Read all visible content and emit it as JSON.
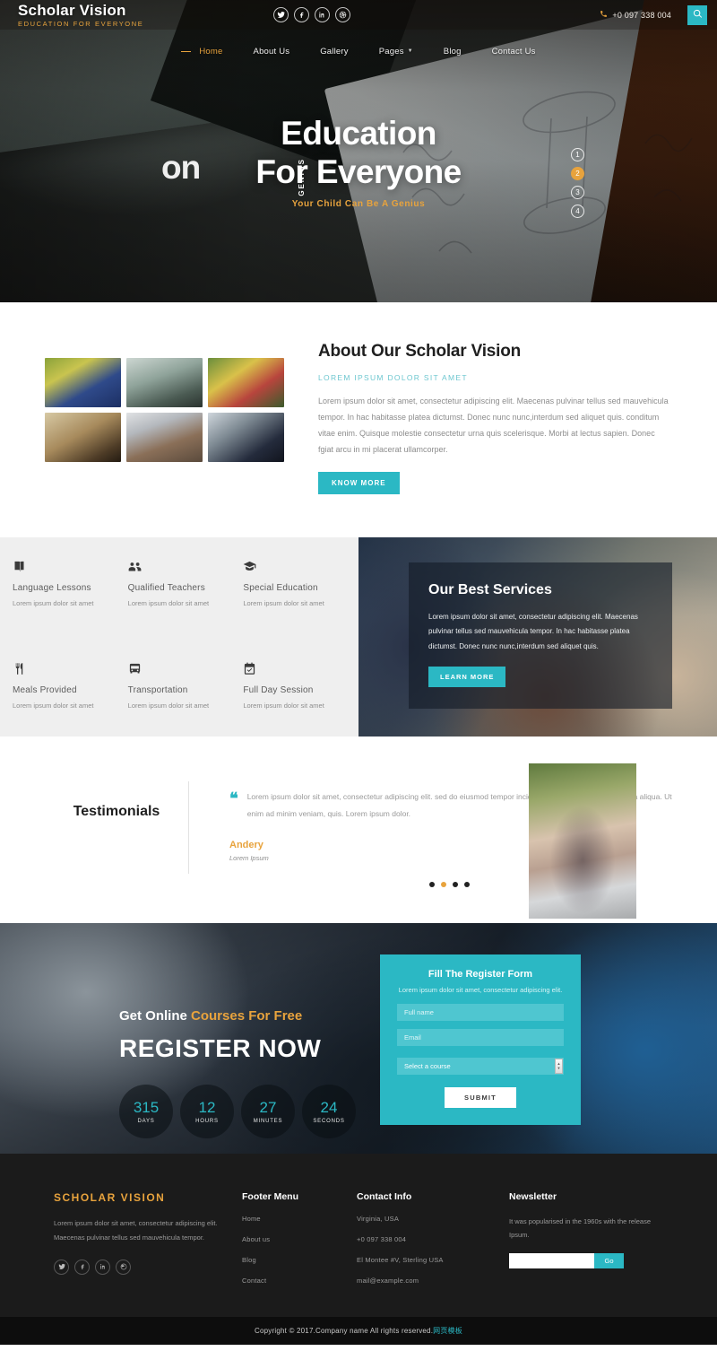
{
  "header": {
    "brand_name": "Scholar Vision",
    "brand_tagline": "Education For Everyone",
    "phone": "+0 097 338 004",
    "social": [
      {
        "name": "twitter-icon",
        "label": "Twitter"
      },
      {
        "name": "facebook-icon",
        "label": "Facebook"
      },
      {
        "name": "linkedin-icon",
        "label": "LinkedIn"
      },
      {
        "name": "dribbble-icon",
        "label": "Dribbble"
      }
    ],
    "search_icon": "search-icon",
    "nav": [
      {
        "label": "Home",
        "active": true
      },
      {
        "label": "About Us",
        "active": false
      },
      {
        "label": "Gallery",
        "active": false
      },
      {
        "label": "Pages",
        "active": false,
        "dropdown": true
      },
      {
        "label": "Blog",
        "active": false
      },
      {
        "label": "Contact Us",
        "active": false
      }
    ]
  },
  "hero": {
    "vertical_word": "GENIUS",
    "ghost_text": "on",
    "title_line1": "Education",
    "title_line2": "For Everyone",
    "subtitle": "Your Child Can Be A Genius",
    "slides": [
      "1",
      "2",
      "3",
      "4"
    ],
    "active_slide": "2"
  },
  "about": {
    "title": "About Our Scholar Vision",
    "kicker": "Lorem ipsum dolor sit amet",
    "body": "Lorem ipsum dolor sit amet, consectetur adipiscing elit. Maecenas pulvinar tellus sed mauvehicula tempor. In hac habitasse platea dictumst. Donec nunc nunc,interdum sed aliquet quis. conditum vitae enim. Quisque molestie consectetur urna quis scelerisque. Morbi at lectus sapien. Donec fgiat arcu in mi placerat ullamcorper.",
    "button": "KNOW MORE",
    "images": [
      "graduate-student-photo",
      "students-library-photo",
      "classroom-crafts-photo",
      "study-desk-photo",
      "bookshelves-photo",
      "graduation-cap-photo"
    ]
  },
  "features": [
    {
      "icon": "book-icon",
      "title": "Language Lessons",
      "desc": "Lorem ipsum dolor sit amet"
    },
    {
      "icon": "users-icon",
      "title": "Qualified Teachers",
      "desc": "Lorem ipsum dolor sit amet"
    },
    {
      "icon": "graduation-cap-icon",
      "title": "Special Education",
      "desc": "Lorem ipsum dolor sit amet"
    },
    {
      "icon": "utensils-icon",
      "title": "Meals Provided",
      "desc": "Lorem ipsum dolor sit amet"
    },
    {
      "icon": "bus-icon",
      "title": "Transportation",
      "desc": "Lorem ipsum dolor sit amet"
    },
    {
      "icon": "calendar-check-icon",
      "title": "Full Day Session",
      "desc": "Lorem ipsum dolor sit amet"
    }
  ],
  "services": {
    "title": "Our Best Services",
    "body": "Lorem ipsum dolor sit amet, consectetur adipiscing elit. Maecenas pulvinar tellus sed mauvehicula tempor. In hac habitasse platea dictumst. Donec nunc nunc,interdum sed aliquet quis.",
    "button": "LEARN MORE"
  },
  "testimonials": {
    "heading": "Testimonials",
    "quote_icon": "quote-icon",
    "text": "Lorem ipsum dolor sit amet, consectetur adipiscing elit. sed do eiusmod tempor incididunt ut labore et dolore magna aliqua. Ut enim ad minim veniam, quis. Lorem ipsum dolor.",
    "author": "Andery",
    "role": "Lorem Ipsum",
    "dots": 4,
    "active_dot": 2,
    "photo": "woman-portrait-photo"
  },
  "register": {
    "kicker_plain_1": "Get Online ",
    "kicker_gold": "Courses For Free",
    "heading": "REGISTER NOW",
    "countdown": [
      {
        "value": "315",
        "label": "DAYS"
      },
      {
        "value": "12",
        "label": "HOURS"
      },
      {
        "value": "27",
        "label": "MINUTES"
      },
      {
        "value": "24",
        "label": "SECONDS"
      }
    ],
    "form": {
      "title": "Fill The Register Form",
      "subtitle": "Lorem ipsum dolor sit amet, consectetur adipiscing elit.",
      "name_placeholder": "Full name",
      "name_value": "",
      "email_placeholder": "Email",
      "email_value": "",
      "select_value": "Select a course",
      "submit": "SUBMIT"
    }
  },
  "footer": {
    "brand": "SCHOLAR VISION",
    "about": "Lorem ipsum dolor sit amet, consectetur adipiscing elit. Maecenas pulvinar tellus sed mauvehicula tempor.",
    "social": [
      {
        "name": "twitter-icon",
        "label": "Twitter"
      },
      {
        "name": "facebook-icon",
        "label": "Facebook"
      },
      {
        "name": "linkedin-icon",
        "label": "LinkedIn"
      },
      {
        "name": "dribbble-icon",
        "label": "Dribbble"
      }
    ],
    "menu_head": "Footer Menu",
    "menu": [
      "Home",
      "About us",
      "Blog",
      "Contact"
    ],
    "contact_head": "Contact Info",
    "contact": [
      "Virginia, USA",
      "+0 097 338 004",
      "El Montee #V, Sterling USA",
      "mail@example.com"
    ],
    "newsletter_head": "Newsletter",
    "newsletter_text": "It was popularised in the 1960s with the release Ipsum.",
    "newsletter_value": "",
    "newsletter_placeholder": "",
    "newsletter_button": "Go",
    "copyright": "Copyright © 2017.Company name All rights reserved.",
    "copyright_cn": "网页模板"
  },
  "colors": {
    "teal": "#2bb8c4",
    "gold": "#e8a33d",
    "dark": "#1b1b1b",
    "grey_bg": "#efefef"
  }
}
